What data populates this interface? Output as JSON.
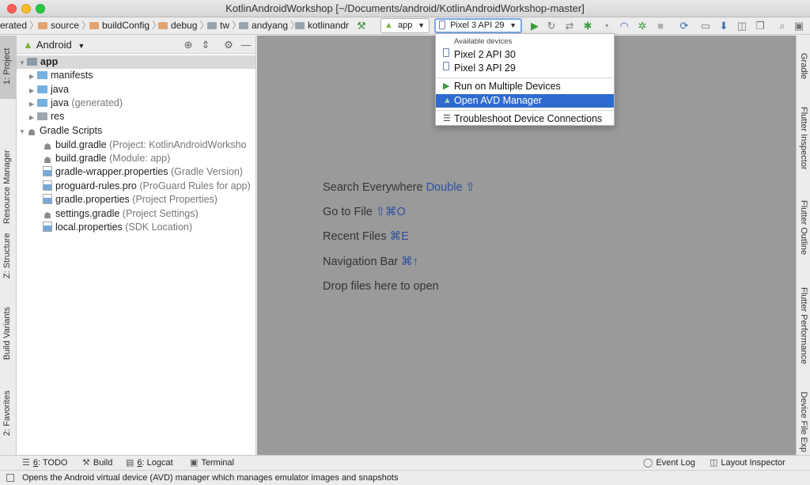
{
  "window": {
    "title": "KotlinAndroidWorkshop [~/Documents/android/KotlinAndroidWorkshop-master]"
  },
  "breadcrumbs": [
    "erated",
    "source",
    "buildConfig",
    "debug",
    "tw",
    "andyang",
    "kotlinandr"
  ],
  "toolbar": {
    "config_combo": "app",
    "device_combo": "Pixel 3 API 29",
    "icons": [
      "hammer-icon",
      "android-icon",
      "run-icon",
      "apply-changes-icon",
      "apply-code-changes-icon",
      "debug-icon",
      "profile-icon",
      "attach-debugger-icon",
      "stop-icon",
      "sync-icon",
      "avd-manager-icon",
      "sdk-manager-icon",
      "layout-inspector-icon",
      "search-icon",
      "project-structure-icon"
    ]
  },
  "device_dropdown": {
    "header": "Available devices",
    "devices": [
      "Pixel 2 API 30",
      "Pixel 3 API 29"
    ],
    "actions": [
      "Run on Multiple Devices",
      "Open AVD Manager"
    ],
    "troubleshoot": "Troubleshoot Device Connections",
    "highlighted": "Open AVD Manager"
  },
  "project_panel": {
    "view_mode": "Android",
    "root": "app",
    "tree": [
      {
        "label": "manifests",
        "note": ""
      },
      {
        "label": "java",
        "note": ""
      },
      {
        "label": "java",
        "note": "(generated)"
      },
      {
        "label": "res",
        "note": ""
      }
    ],
    "gradle_scripts": "Gradle Scripts",
    "gradle_files": [
      {
        "label": "build.gradle",
        "note": "(Project: KotlinAndroidWorksho"
      },
      {
        "label": "build.gradle",
        "note": "(Module: app)"
      },
      {
        "label": "gradle-wrapper.properties",
        "note": "(Gradle Version)"
      },
      {
        "label": "proguard-rules.pro",
        "note": "(ProGuard Rules for app)"
      },
      {
        "label": "gradle.properties",
        "note": "(Project Properties)"
      },
      {
        "label": "settings.gradle",
        "note": "(Project Settings)"
      },
      {
        "label": "local.properties",
        "note": "(SDK Location)"
      }
    ]
  },
  "left_tabs": [
    "1: Project",
    "Resource Manager",
    "Z: Structure",
    "Build Variants",
    "2: Favorites"
  ],
  "right_tabs": [
    "Gradle",
    "Flutter Inspector",
    "Flutter Outline",
    "Flutter Performance",
    "Device File Exp"
  ],
  "editor_hints": [
    {
      "text": "Search Everywhere",
      "key": "Double ⇧"
    },
    {
      "text": "Go to File",
      "key": "⇧⌘O"
    },
    {
      "text": "Recent Files",
      "key": "⌘E"
    },
    {
      "text": "Navigation Bar",
      "key": "⌘↑"
    },
    {
      "text": "Drop files here to open",
      "key": ""
    }
  ],
  "bottom_tabs": {
    "todo_num": "6",
    "todo": ": TODO",
    "build": "Build",
    "logcat_num": "6",
    "logcat": ": Logcat",
    "terminal": "Terminal",
    "event_log": "Event Log",
    "layout_inspector": "Layout Inspector"
  },
  "status": {
    "message": "Opens the Android virtual device (AVD) manager which manages emulator images and snapshots"
  },
  "colors": {
    "highlight": "#2e6bd1",
    "editor_bg": "#9a9a9a",
    "shortcut": "#2c4fa0",
    "android_green": "#7cb342"
  }
}
